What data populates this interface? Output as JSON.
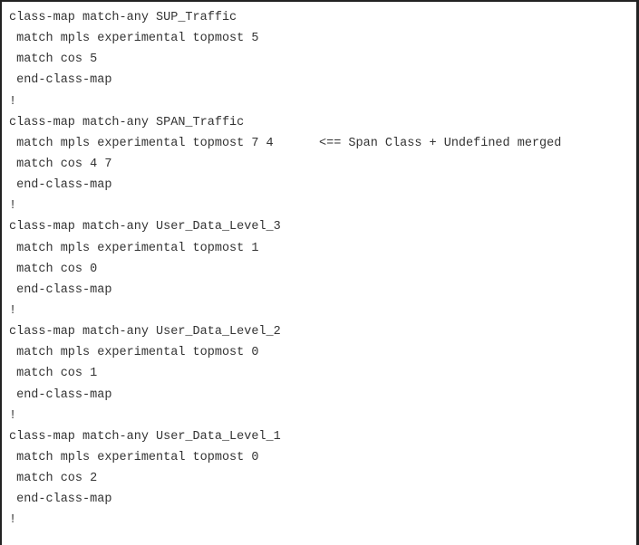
{
  "lines": [
    {
      "text": "class-map match-any SUP_Traffic"
    },
    {
      "text": " match mpls experimental topmost 5"
    },
    {
      "text": " match cos 5"
    },
    {
      "text": " end-class-map"
    },
    {
      "text": "!"
    },
    {
      "text": "class-map match-any SPAN_Traffic"
    },
    {
      "text": " match mpls experimental topmost 7 4",
      "comment": "<== Span Class + Undefined merged"
    },
    {
      "text": " match cos 4 7"
    },
    {
      "text": " end-class-map"
    },
    {
      "text": "!"
    },
    {
      "text": "class-map match-any User_Data_Level_3"
    },
    {
      "text": " match mpls experimental topmost 1"
    },
    {
      "text": " match cos 0"
    },
    {
      "text": " end-class-map"
    },
    {
      "text": "!"
    },
    {
      "text": "class-map match-any User_Data_Level_2"
    },
    {
      "text": " match mpls experimental topmost 0"
    },
    {
      "text": " match cos 1"
    },
    {
      "text": " end-class-map"
    },
    {
      "text": "!"
    },
    {
      "text": "class-map match-any User_Data_Level_1"
    },
    {
      "text": " match mpls experimental topmost 0"
    },
    {
      "text": " match cos 2"
    },
    {
      "text": " end-class-map"
    },
    {
      "text": "!"
    }
  ]
}
